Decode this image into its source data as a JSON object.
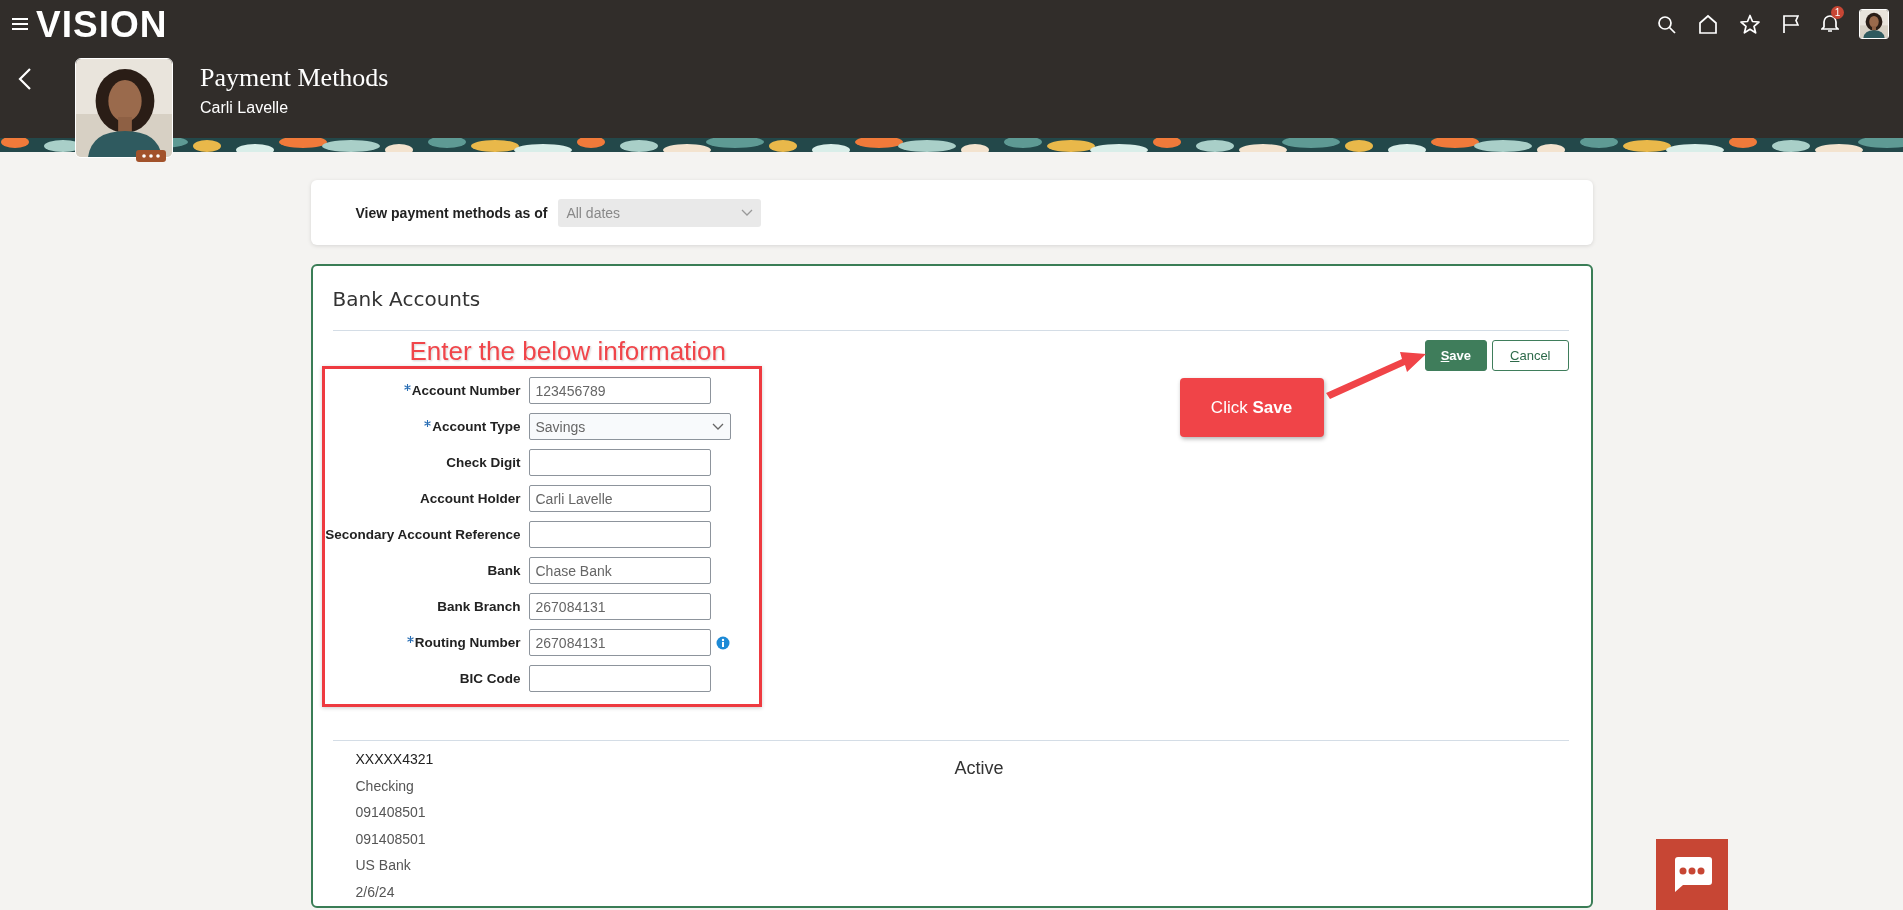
{
  "header": {
    "logo": "VISION",
    "notification_count": "1"
  },
  "page": {
    "title": "Payment Methods",
    "subtitle": "Carli Lavelle"
  },
  "filter": {
    "label": "View payment methods as of",
    "value": "All dates",
    "disabled": true
  },
  "bank_accounts": {
    "title": "Bank Accounts",
    "buttons": [
      {
        "label": "Save",
        "kind": "primary"
      },
      {
        "label": "Cancel",
        "kind": "secondary"
      }
    ],
    "fields": [
      {
        "label": "Account Number",
        "kind": "text",
        "required": true,
        "value": "123456789"
      },
      {
        "label": "Account Type",
        "kind": "select",
        "required": true,
        "value": "Savings"
      },
      {
        "label": "Check Digit",
        "kind": "text",
        "required": false
      },
      {
        "label": "Account Holder",
        "kind": "text",
        "required": false,
        "value": "Carli Lavelle"
      },
      {
        "label": "Secondary Account Reference",
        "kind": "text",
        "required": false
      },
      {
        "label": "Bank",
        "kind": "text",
        "required": false,
        "value": "Chase Bank"
      },
      {
        "label": "Bank Branch",
        "kind": "text",
        "required": false,
        "value": "267084131"
      },
      {
        "label": "Routing Number",
        "kind": "text",
        "required": true,
        "value": "267084131",
        "info": true
      },
      {
        "label": "BIC Code",
        "kind": "text",
        "required": false
      }
    ],
    "accounts": [
      {
        "lines": [
          "XXXXX4321",
          "Checking",
          "091408501",
          "091408501",
          "US Bank",
          "2/6/24"
        ],
        "status": "Active"
      }
    ]
  },
  "annotations": {
    "instruction": "Enter the below information",
    "callout": "Click **Save**"
  }
}
